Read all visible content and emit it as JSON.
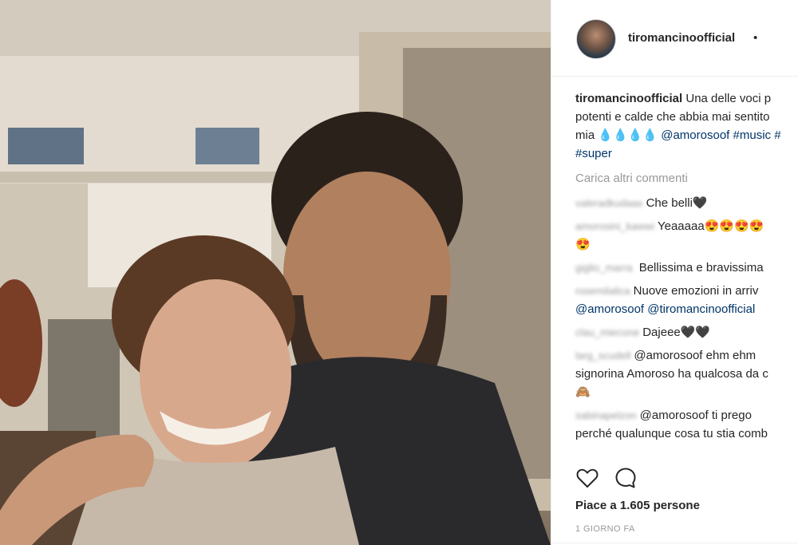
{
  "post": {
    "username": "tiromancinoofficial",
    "follow_dot": "•",
    "caption": {
      "username": "tiromancinoofficial",
      "line1_text": "Una delle voci p",
      "line2_text": "potenti e calde che abbia mai sentito",
      "line3_prefix": "mia",
      "line3_drops": "💧💧💧💧",
      "line3_mention": "@amorosoof",
      "line3_tag1": "#music",
      "line3_tag2": "#",
      "line4_tag": "#super"
    },
    "load_more": "Carica altri commenti",
    "comments": [
      {
        "user": "valeradkudaax",
        "line1": "Che belli🖤",
        "line2": ""
      },
      {
        "user": "amorosini_kawwi",
        "line1": "Yeaaaaa😍😍😍😍",
        "line2": "😍"
      },
      {
        "user": "giglio_marra",
        "line1": " Bellissima e bravissima",
        "line2": ""
      },
      {
        "user": "rosemilalica",
        "line1": "Nuove emozioni in arriv",
        "line2": "@amorosoof @tiromancinoofficial"
      },
      {
        "user": "clau_miecone",
        "line1": "Dajeee🖤🖤",
        "line2": ""
      },
      {
        "user": "larg_scudell",
        "line1": "@amorosoof ehm ehm",
        "line2": "signorina Amoroso ha qualcosa da c",
        "line3": "🙈"
      },
      {
        "user": "sabinapelzon",
        "line1": "@amorosoof ti prego",
        "line2": "perché qualunque cosa tu stia comb"
      }
    ],
    "likes": "Piace a 1.605 persone",
    "time": "1 GIORNO FA"
  },
  "icons": {
    "like": "heart-icon",
    "comment": "comment-bubble-icon"
  },
  "colors": {
    "text": "#262626",
    "muted": "#999999",
    "link": "#003569",
    "border": "#efefef"
  }
}
